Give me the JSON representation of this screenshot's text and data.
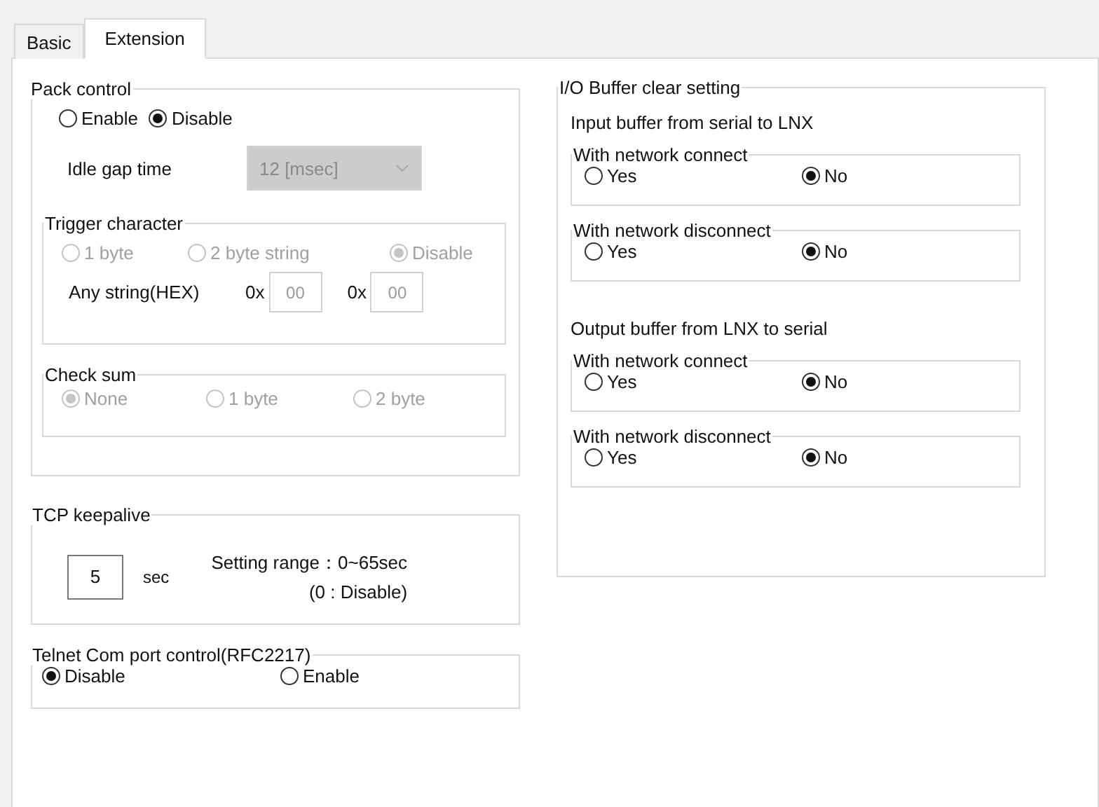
{
  "tabs": [
    {
      "label": "Basic",
      "selected": false
    },
    {
      "label": "Extension",
      "selected": true
    }
  ],
  "pack_control": {
    "title": "Pack control",
    "options": [
      {
        "label": "Enable",
        "selected": false
      },
      {
        "label": "Disable",
        "selected": true
      }
    ],
    "idle_gap": {
      "label": "Idle gap time",
      "value": "12 [msec]",
      "disabled": true
    },
    "trigger": {
      "title": "Trigger character",
      "disabled": true,
      "options": [
        {
          "label": "1 byte",
          "selected": false
        },
        {
          "label": "2 byte string",
          "selected": false
        },
        {
          "label": "Disable",
          "selected": true
        }
      ],
      "hex_label": "Any string(HEX)",
      "fields": [
        {
          "prefix": "0x",
          "value": "00"
        },
        {
          "prefix": "0x",
          "value": "00"
        }
      ]
    },
    "check_sum": {
      "title": "Check sum",
      "disabled": true,
      "options": [
        {
          "label": "None",
          "selected": true
        },
        {
          "label": "1 byte",
          "selected": false
        },
        {
          "label": "2 byte",
          "selected": false
        }
      ]
    }
  },
  "tcp_keepalive": {
    "title": "TCP keepalive",
    "value": "5",
    "unit": "sec",
    "range": "Setting range：0~65sec",
    "note": "(0 : Disable)"
  },
  "telnet": {
    "title": "Telnet Com port control(RFC2217)",
    "options": [
      {
        "label": "Disable",
        "selected": true
      },
      {
        "label": "Enable",
        "selected": false
      }
    ]
  },
  "io_buffer": {
    "title": "I/O Buffer clear setting",
    "sections": [
      {
        "heading": "Input buffer from serial to LNX",
        "groups": [
          {
            "title": "With network connect",
            "options": [
              {
                "label": "Yes",
                "selected": false
              },
              {
                "label": "No",
                "selected": true
              }
            ]
          },
          {
            "title": "With network disconnect",
            "options": [
              {
                "label": "Yes",
                "selected": false
              },
              {
                "label": "No",
                "selected": true
              }
            ]
          }
        ]
      },
      {
        "heading": "Output buffer from LNX to serial",
        "groups": [
          {
            "title": "With network connect",
            "options": [
              {
                "label": "Yes",
                "selected": false
              },
              {
                "label": "No",
                "selected": true
              }
            ]
          },
          {
            "title": "With network disconnect",
            "options": [
              {
                "label": "Yes",
                "selected": false
              },
              {
                "label": "No",
                "selected": true
              }
            ]
          }
        ]
      }
    ]
  }
}
